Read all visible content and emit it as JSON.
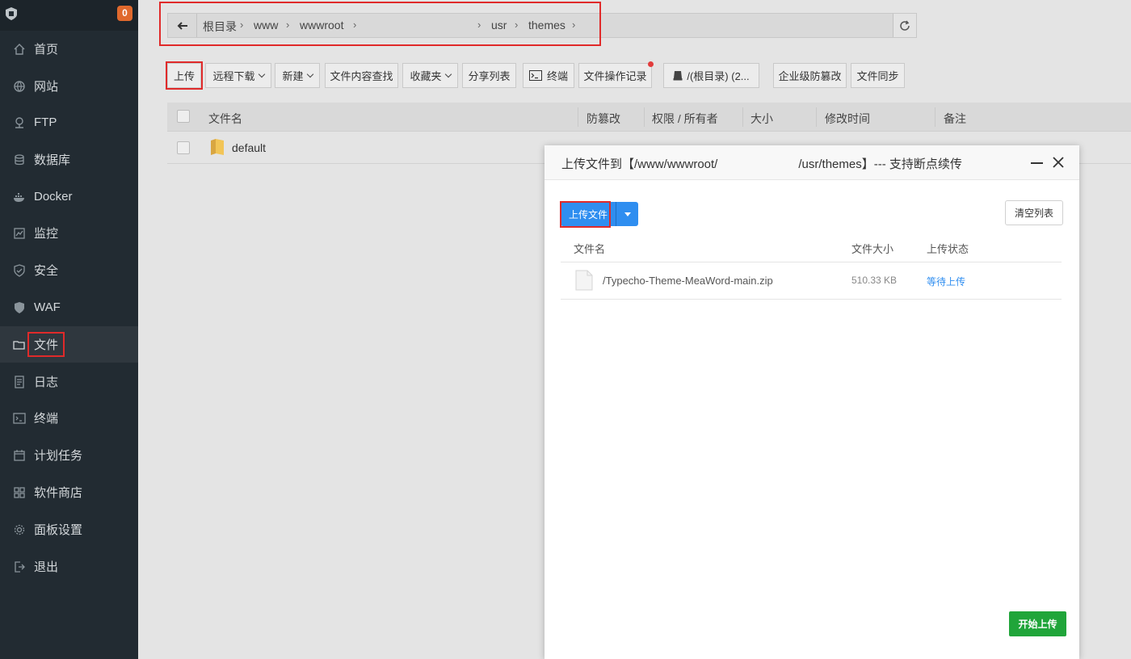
{
  "sidebar": {
    "badge": "0",
    "items": [
      {
        "label": "首页",
        "icon": "home-icon"
      },
      {
        "label": "网站",
        "icon": "globe-icon"
      },
      {
        "label": "FTP",
        "icon": "ftp-icon"
      },
      {
        "label": "数据库",
        "icon": "database-icon"
      },
      {
        "label": "Docker",
        "icon": "docker-icon"
      },
      {
        "label": "监控",
        "icon": "monitor-icon"
      },
      {
        "label": "安全",
        "icon": "shield-icon"
      },
      {
        "label": "WAF",
        "icon": "waf-icon"
      },
      {
        "label": "文件",
        "icon": "folder-icon",
        "active": true
      },
      {
        "label": "日志",
        "icon": "log-icon"
      },
      {
        "label": "终端",
        "icon": "terminal-icon"
      },
      {
        "label": "计划任务",
        "icon": "calendar-icon"
      },
      {
        "label": "软件商店",
        "icon": "apps-icon"
      },
      {
        "label": "面板设置",
        "icon": "gear-icon"
      },
      {
        "label": "退出",
        "icon": "logout-icon"
      }
    ]
  },
  "path": {
    "crumbs": [
      "根目录",
      "www",
      "wwwroot",
      "usr",
      "themes"
    ]
  },
  "toolbar": {
    "upload": "上传",
    "remote_download": "远程下载",
    "new": "新建",
    "content_search": "文件内容查找",
    "favorites": "收藏夹",
    "share_list": "分享列表",
    "terminal": "终端",
    "op_log": "文件操作记录",
    "disk": "/(根目录) (2...",
    "tamper": "企业级防篡改",
    "sync": "文件同步"
  },
  "table": {
    "headers": [
      "文件名",
      "防篡改",
      "权限 / 所有者",
      "大小",
      "修改时间",
      "备注"
    ],
    "rows": [
      {
        "name": "default"
      }
    ]
  },
  "dialog": {
    "title": "上传文件到【/www/wwwroot/                        /usr/themes】--- 支持断点续传",
    "upload_btn": "上传文件",
    "clear_btn": "清空列表",
    "headers": {
      "name": "文件名",
      "size": "文件大小",
      "status": "上传状态"
    },
    "files": [
      {
        "name": "/Typecho-Theme-MeaWord-main.zip",
        "size": "510.33 KB",
        "status": "等待上传"
      }
    ],
    "start_btn": "开始上传"
  },
  "colors": {
    "sidebar_bg": "#222b32",
    "badge": "#e0692d",
    "primary_blue": "#2f8ef0",
    "start_green": "#20a53a",
    "highlight_red": "#e02a2a"
  }
}
